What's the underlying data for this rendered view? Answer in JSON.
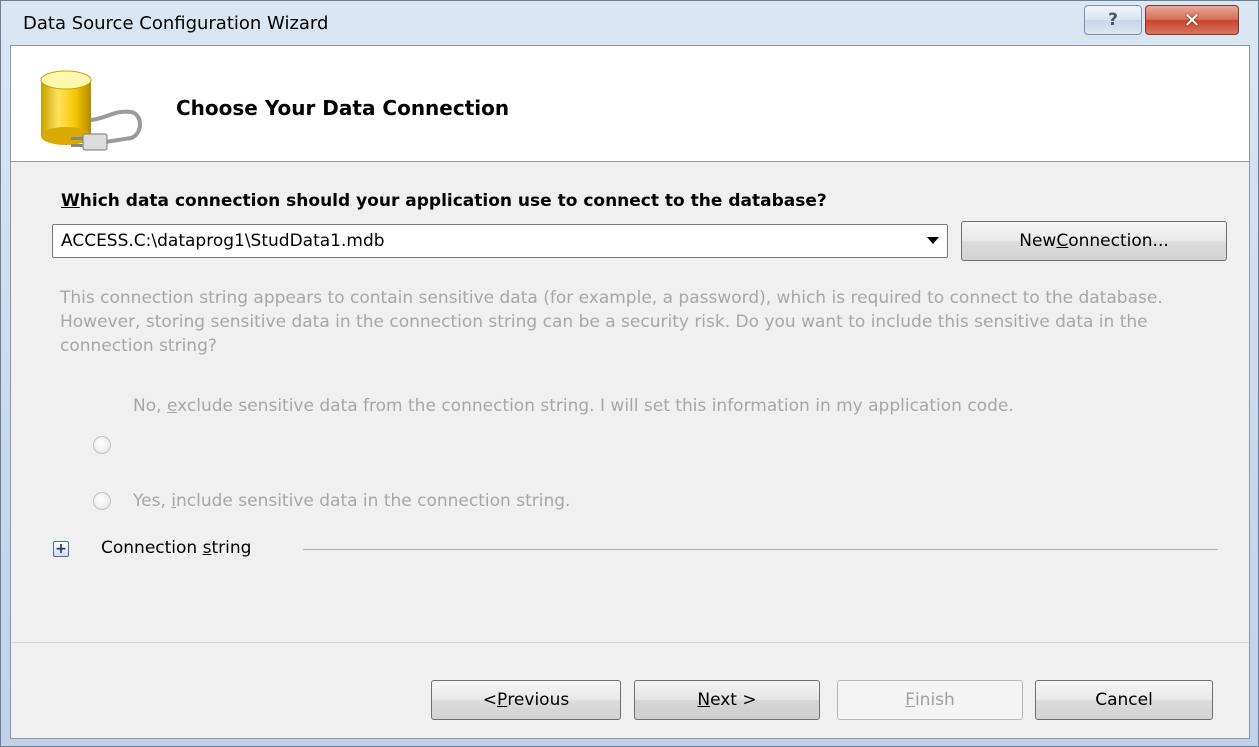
{
  "window": {
    "title": "Data Source Configuration Wizard",
    "help_glyph": "?",
    "close_glyph": "✕"
  },
  "header": {
    "title": "Choose Your Data Connection",
    "icon": "database-plug-icon"
  },
  "question": {
    "accesskey": "W",
    "rest": "hich data connection should your application use to connect to the database?"
  },
  "connection_select": {
    "value": "ACCESS.C:\\dataprog1\\StudData1.mdb"
  },
  "new_connection_button": {
    "pre": "New ",
    "accesskey": "C",
    "post": "onnection..."
  },
  "sensitive": {
    "description": "This connection string appears to contain sensitive data (for example, a password), which is required to connect to the database. However, storing sensitive data in the connection string can be a security risk. Do you want to include this sensitive data in the connection string?",
    "option_no": {
      "pre": "No, ",
      "accesskey": "e",
      "post": "xclude sensitive data from the connection string. I will set this information in my application code."
    },
    "option_yes": {
      "pre": "Yes, ",
      "accesskey": "i",
      "post": "nclude sensitive data in the connection string."
    }
  },
  "connection_string": {
    "expander": "+",
    "pre": "Connection ",
    "accesskey": "s",
    "post": "tring"
  },
  "buttons": {
    "previous": {
      "pre": "< ",
      "accesskey": "P",
      "post": "revious"
    },
    "next": {
      "accesskey": "N",
      "post": "ext >"
    },
    "finish": {
      "accesskey": "F",
      "post": "inish"
    },
    "cancel": "Cancel"
  }
}
